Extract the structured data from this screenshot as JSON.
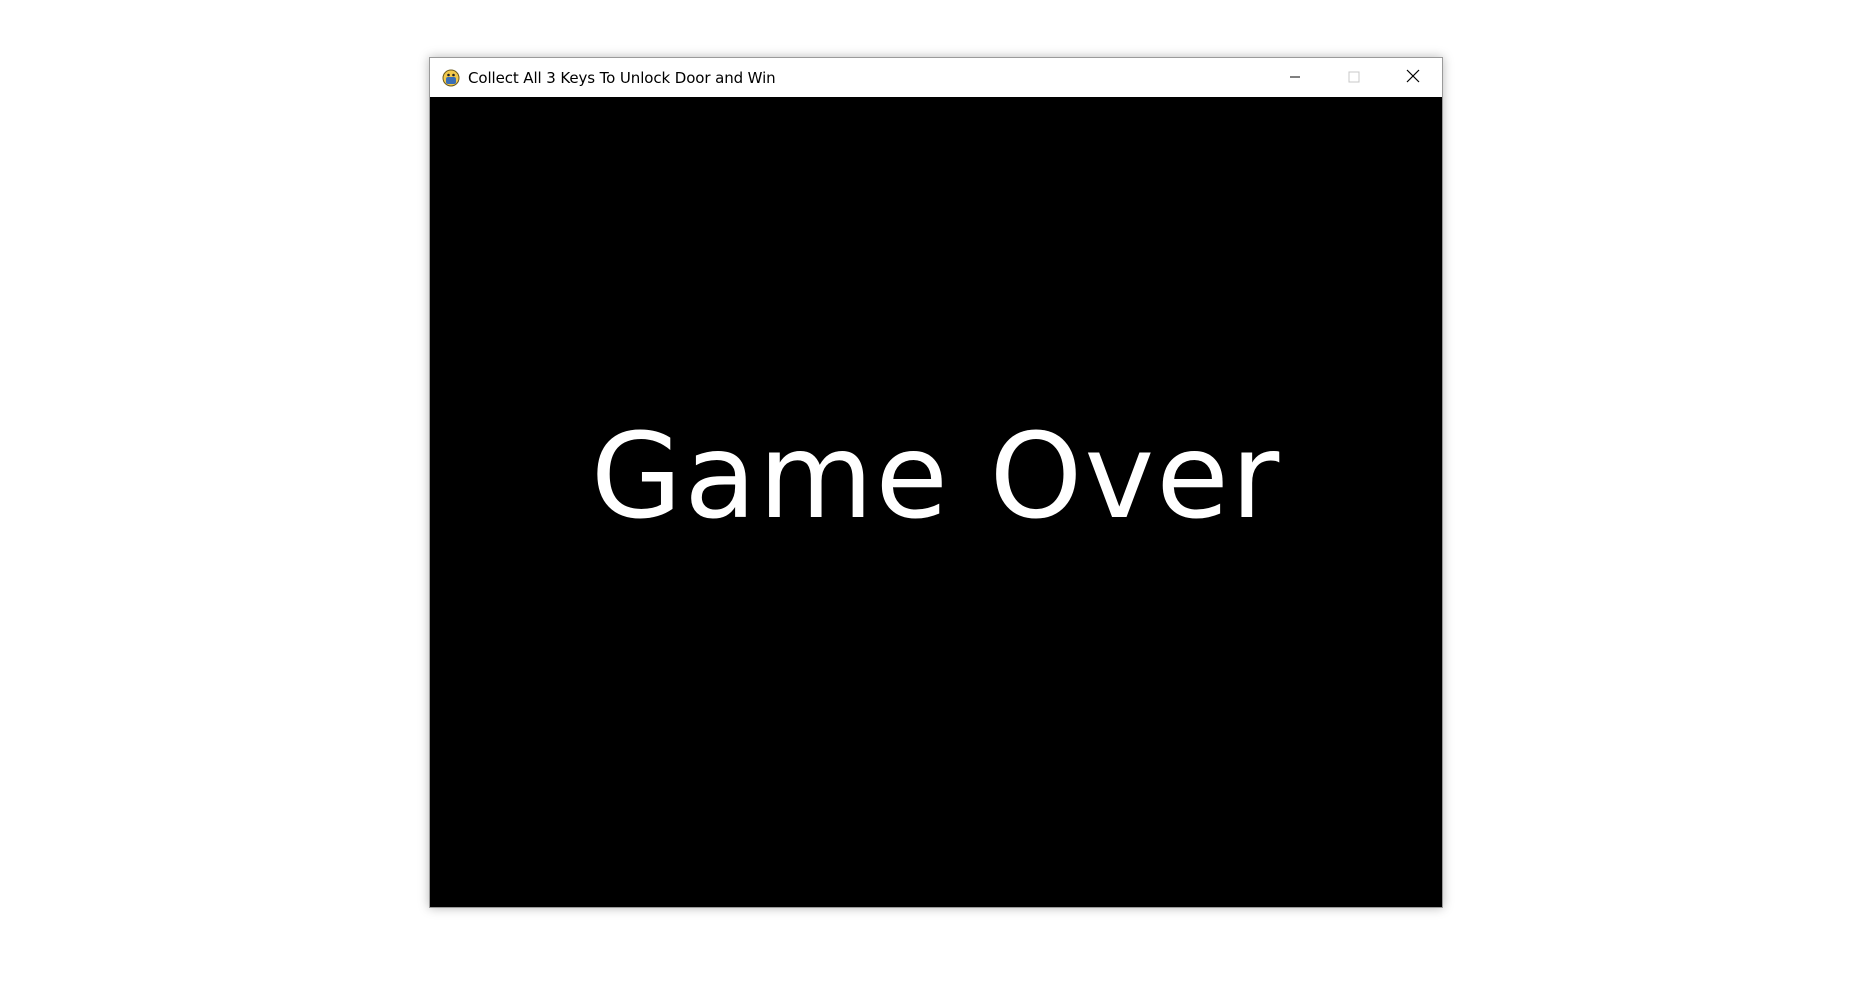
{
  "window": {
    "title": "Collect All 3 Keys To Unlock Door and Win",
    "app_icon": "pygame-snake-icon",
    "controls": {
      "minimize_icon": "minimize-icon",
      "maximize_icon": "maximize-icon",
      "close_icon": "close-icon"
    }
  },
  "game": {
    "message": "Game Over",
    "background_color": "#000000",
    "text_color": "#ffffff"
  }
}
